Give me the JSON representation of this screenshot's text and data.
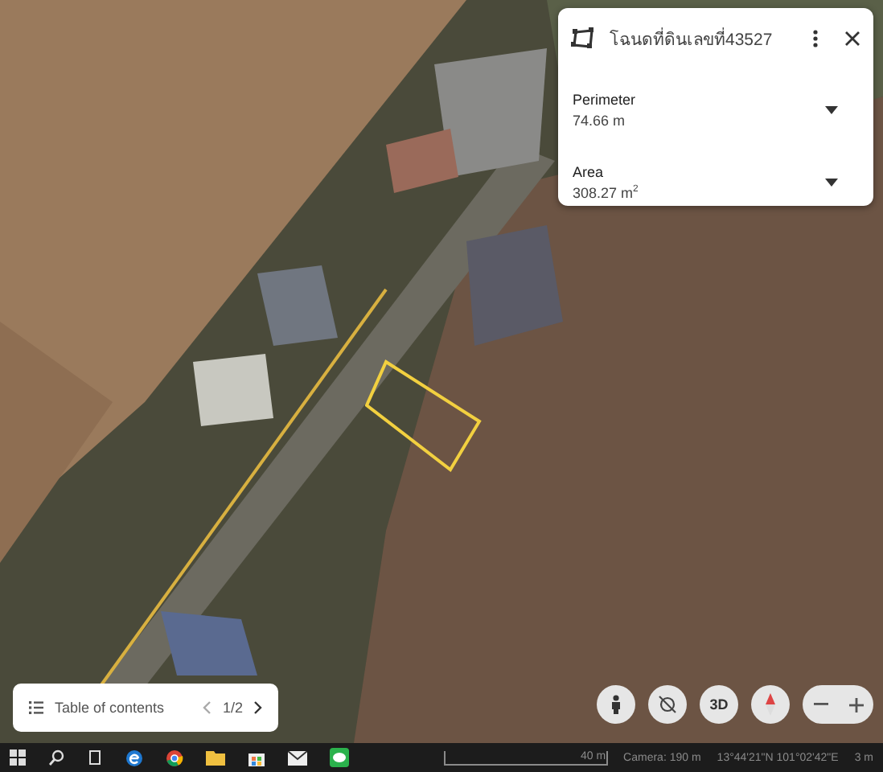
{
  "panel": {
    "title": "โฉนดที่ดินเลขที่43527",
    "measurements": [
      {
        "label": "Perimeter",
        "value": "74.66 m"
      },
      {
        "label": "Area",
        "value": "308.27 m$^{2}$"
      }
    ]
  },
  "toc": {
    "label": "Table of contents",
    "page": "1/2"
  },
  "map_controls": {
    "view_3d": "3D"
  },
  "status_bar": {
    "scale": "40 m",
    "camera": "Camera: 190 m",
    "coordinates": "13°44'21\"N 101°02'42\"E",
    "elevation": "3 m"
  }
}
